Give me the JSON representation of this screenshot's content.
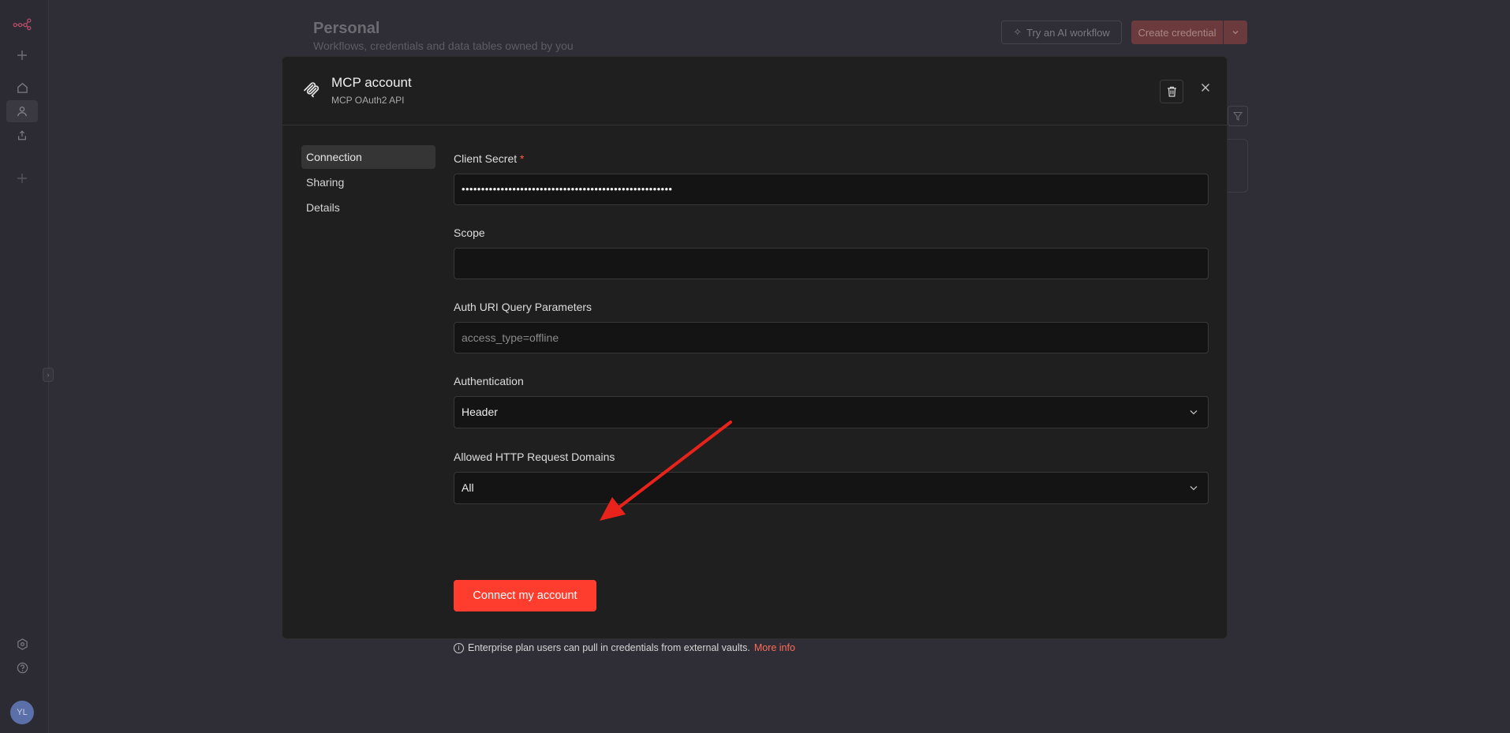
{
  "background_page": {
    "title": "Personal",
    "subtitle": "Workflows, credentials and data tables owned by you",
    "try_ai_button": "Try an AI workflow",
    "create_credential_button": "Create credential"
  },
  "sidebar": {
    "avatar_initials": "YL",
    "icons": [
      "n8n-logo-icon",
      "plus-icon",
      "home-icon",
      "user-icon",
      "share-icon",
      "plus-icon",
      "templates-icon",
      "help-icon"
    ]
  },
  "modal": {
    "title": "MCP account",
    "subtitle": "MCP OAuth2 API",
    "nav": [
      {
        "label": "Connection",
        "active": true
      },
      {
        "label": "Sharing",
        "active": false
      },
      {
        "label": "Details",
        "active": false
      }
    ],
    "fields": {
      "client_secret": {
        "label": "Client Secret",
        "required_mark": "*",
        "value": "••••••••••••••••••••••••••••••••••••••••••••••••••••••"
      },
      "scope": {
        "label": "Scope",
        "value": ""
      },
      "auth_uri_query": {
        "label": "Auth URI Query Parameters",
        "placeholder": "access_type=offline"
      },
      "authentication": {
        "label": "Authentication",
        "value": "Header"
      },
      "allowed_domains": {
        "label": "Allowed HTTP Request Domains",
        "value": "All"
      }
    },
    "connect_button": "Connect my account",
    "info_text": "Enterprise plan users can pull in credentials from external vaults.",
    "more_info_link": "More info"
  },
  "colors": {
    "accent": "#ff3d2e",
    "modal_bg": "#1f1f1f",
    "page_bg": "#2f2e36",
    "annotation_arrow": "#e8231b"
  }
}
